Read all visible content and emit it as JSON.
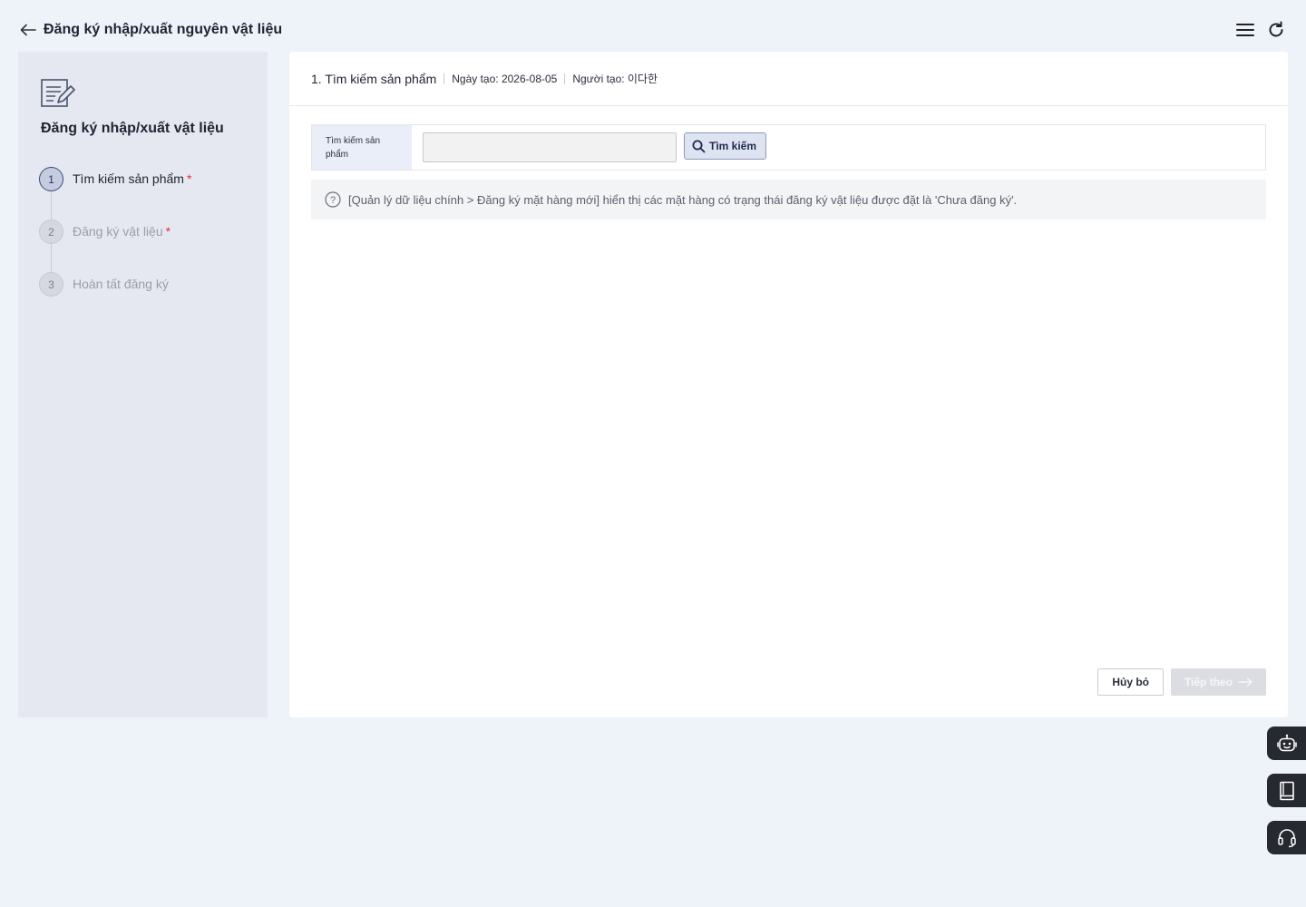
{
  "header": {
    "title": "Đăng ký nhập/xuất nguyên vật liệu"
  },
  "sidebar": {
    "title": "Đăng ký nhập/xuất vật liệu",
    "steps": [
      {
        "number": "1",
        "label": "Tìm kiếm sản phẩm",
        "required": "*",
        "state": "active"
      },
      {
        "number": "2",
        "label": "Đăng ký vật liệu",
        "required": "*",
        "state": "inactive"
      },
      {
        "number": "3",
        "label": "Hoàn tất đăng ký",
        "required": "",
        "state": "inactive"
      }
    ]
  },
  "main": {
    "section_title": "1. Tìm kiếm sản phẩm",
    "created_date": "Ngày tạo: 2026-08-05",
    "creator": "Người tạo: 이다한",
    "search": {
      "label": "Tìm kiếm sản phẩm",
      "value": "",
      "placeholder": "",
      "button_label": "Tìm kiếm"
    },
    "info_text": "[Quản lý dữ liệu chính > Đăng ký mặt hàng mới] hiển thị các mặt hàng có trạng thái đăng ký vật liệu được đặt là 'Chưa đăng ký'.",
    "cancel_label": "Hủy bỏ",
    "next_label": "Tiếp theo"
  },
  "floating": [
    "robot-icon",
    "book-icon",
    "headset-icon"
  ],
  "colors": {
    "background": "#eef2f9",
    "sidebar": "#e5e8f0",
    "accent": "#3a4a78",
    "required": "#e5303a",
    "floating_button": "#26292f"
  }
}
